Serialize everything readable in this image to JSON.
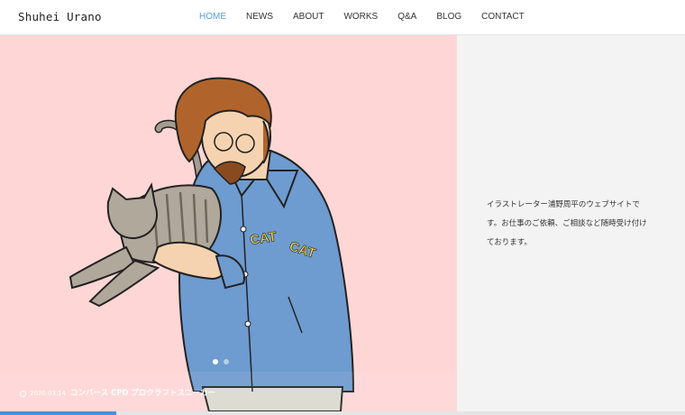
{
  "site": {
    "logo": "Shuhei Urano"
  },
  "nav": [
    {
      "label": "HOME",
      "active": true
    },
    {
      "label": "NEWS"
    },
    {
      "label": "ABOUT"
    },
    {
      "label": "WORKS"
    },
    {
      "label": "Q&A"
    },
    {
      "label": "BLOG"
    },
    {
      "label": "CONTACT"
    }
  ],
  "hero": {
    "patch_left": "CAT",
    "patch_right": "CAT",
    "post_date": "2020.03.14",
    "post_title": "コンバース CPD プロクラフトスニーカー",
    "slides_total": 2,
    "slide_active": 1,
    "progress": 0.17
  },
  "intro": {
    "line1": "イラストレーター浦野周平のウェブサイトで",
    "line2": "す。お仕事のご依頼、ご相談など随時受け付け",
    "line3": "ております。"
  },
  "colors": {
    "hero_bg": "#ffd6d6",
    "side_bg": "#f3f3f3",
    "nav_active": "#5aa0d8",
    "progress": "#4a90d9",
    "jacket": "#6e9bd0",
    "hair": "#b0642c"
  }
}
